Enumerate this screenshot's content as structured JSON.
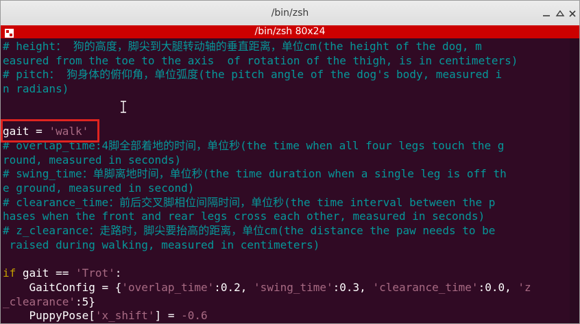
{
  "window": {
    "title": "/bin/zsh",
    "buttons": {
      "minimize": "–",
      "maximize": "□",
      "close": "✕"
    }
  },
  "tab": {
    "title": "/bin/zsh 80x24",
    "icon": "terminal-tab-icon"
  },
  "colors": {
    "background": "#300a24",
    "tabbar": "#cc0000",
    "comment": "#06989a",
    "string": "#a86a83",
    "keyword": "#c4a000",
    "highlight_box": "#e0241f"
  },
  "terminal": {
    "lines": [
      [
        {
          "t": "# height： 狗的高度，脚尖到大腿转动轴的垂直距离，单位cm(the height of the dog, m",
          "c": "cm"
        }
      ],
      [
        {
          "t": "easured from the toe to the axis  of rotation of the thigh, is in centimeters)",
          "c": "cm"
        }
      ],
      [
        {
          "t": "# pitch： 狗身体的俯仰角，单位弧度(the pitch angle of the dog's body, measured i",
          "c": "cm"
        }
      ],
      [
        {
          "t": "n radians)",
          "c": "cm"
        }
      ],
      [
        {
          "t": "",
          "c": ""
        }
      ],
      [
        {
          "t": "",
          "c": ""
        }
      ],
      [
        {
          "t": "gait = ",
          "c": ""
        },
        {
          "t": "'walk'",
          "c": "str"
        }
      ],
      [
        {
          "t": "# overlap_time:4脚全部着地的时间，单位秒(the time when all four legs touch the g",
          "c": "cm"
        }
      ],
      [
        {
          "t": "round, measured in seconds)",
          "c": "cm"
        }
      ],
      [
        {
          "t": "# swing_time：单脚离地时间，单位秒(the time duration when a single leg is off th",
          "c": "cm"
        }
      ],
      [
        {
          "t": "e ground, measured in second)",
          "c": "cm"
        }
      ],
      [
        {
          "t": "# clearance_time：前后交叉脚相位间隔时间，单位秒(the time interval between the p",
          "c": "cm"
        }
      ],
      [
        {
          "t": "hases when the front and rear legs cross each other, measured in seconds)",
          "c": "cm"
        }
      ],
      [
        {
          "t": "# z_clearance：走路时，脚尖要抬高的距离，单位cm(the distance the paw needs to be",
          "c": "cm"
        }
      ],
      [
        {
          "t": " raised during walking, measured in centimeters)",
          "c": "cm"
        }
      ],
      [
        {
          "t": "",
          "c": ""
        }
      ],
      [
        {
          "t": "if",
          "c": "kw"
        },
        {
          "t": " gait == ",
          "c": ""
        },
        {
          "t": "'Trot'",
          "c": "str"
        },
        {
          "t": ":",
          "c": ""
        }
      ],
      [
        {
          "t": "    GaitConfig = {",
          "c": ""
        },
        {
          "t": "'overlap_time'",
          "c": "str"
        },
        {
          "t": ":0.2, ",
          "c": ""
        },
        {
          "t": "'swing_time'",
          "c": "str"
        },
        {
          "t": ":0.3, ",
          "c": ""
        },
        {
          "t": "'clearance_time'",
          "c": "str"
        },
        {
          "t": ":0.0, ",
          "c": ""
        },
        {
          "t": "'z",
          "c": "str"
        }
      ],
      [
        {
          "t": "_clearance'",
          "c": "str"
        },
        {
          "t": ":5}",
          "c": ""
        }
      ],
      [
        {
          "t": "    PuppyPose[",
          "c": ""
        },
        {
          "t": "'x_shift'",
          "c": "str"
        },
        {
          "t": "] = ",
          "c": ""
        },
        {
          "t": "-0.6",
          "c": "num"
        }
      ]
    ]
  }
}
